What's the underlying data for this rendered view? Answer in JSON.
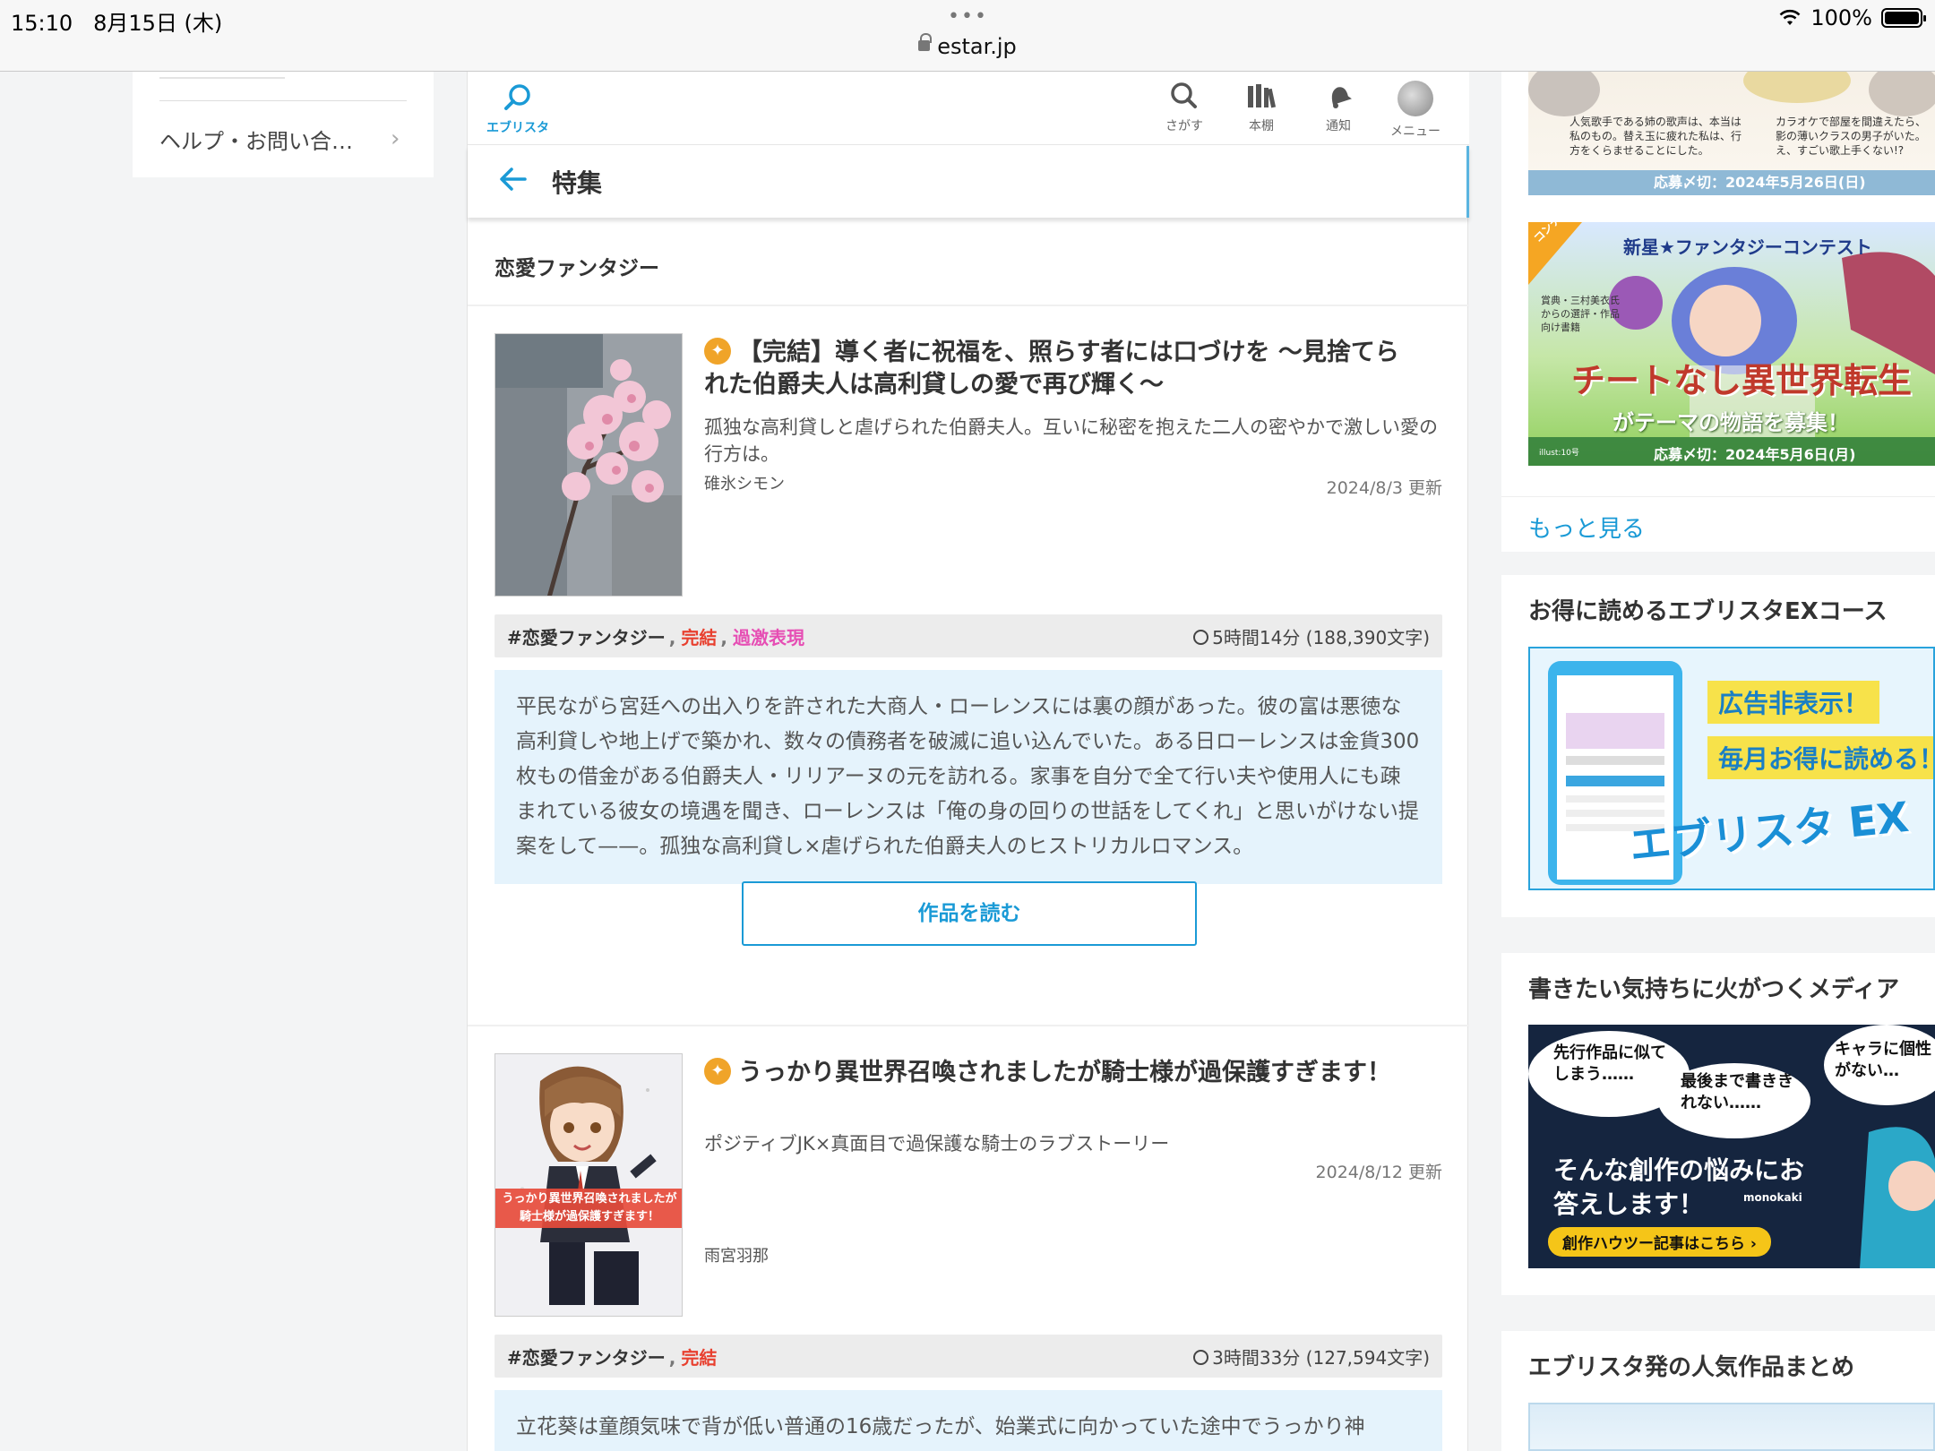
{
  "status_bar": {
    "time": "15:10",
    "date": "8月15日 (木)",
    "dots": "•••",
    "url": "estar.jp",
    "battery": "100%"
  },
  "left_sidebar": {
    "help_label": "ヘルプ・お問い合…",
    "chevron": "›"
  },
  "app_bar": {
    "logo_label": "エブリスタ",
    "nav": [
      {
        "label": "さがす",
        "icon": "search-icon"
      },
      {
        "label": "本棚",
        "icon": "bookshelf-icon"
      },
      {
        "label": "通知",
        "icon": "bell-icon"
      },
      {
        "label": "メニュー",
        "icon": "avatar-icon"
      }
    ]
  },
  "page": {
    "title": "特集",
    "section_title": "恋愛ファンタジー"
  },
  "works": [
    {
      "badge": "✦",
      "title": "【完結】導く者に祝福を、照らす者には口づけを 〜見捨てられた伯爵夫人は高利貸しの愛で再び輝く〜",
      "catch": "孤独な高利貸しと虐げられた伯爵夫人。互いに秘密を抱えた二人の密やかで激しい愛の行方は。",
      "author": "碓氷シモン",
      "updated": "2024/8/3 更新",
      "tags": {
        "genre": "#恋愛ファンタジー",
        "complete": "完結",
        "extreme": "過激表現",
        "sep": ","
      },
      "read_time": "5時間14分 (188,390文字)",
      "synopsis": "平民ながら宮廷への出入りを許された大商人・ローレンスには裏の顔があった。彼の富は悪徳な高利貸しや地上げで築かれ、数々の債務者を破滅に追い込んでいた。ある日ローレンスは金貨300枚もの借金がある伯爵夫人・リリアーヌの元を訪れる。家事を自分で全て行い夫や使用人にも疎まれている彼女の境遇を聞き、ローレンスは「俺の身の回りの世話をしてくれ」と思いがけない提案をして——。孤独な高利貸し×虐げられた伯爵夫人のヒストリカルロマンス。",
      "read_button": "作品を読む"
    },
    {
      "badge": "✦",
      "title": "うっかり異世界召喚されましたが騎士様が過保護すぎます！",
      "catch": "ポジティブJK×真面目で過保護な騎士のラブストーリー",
      "author": "雨宮羽那",
      "updated": "2024/8/12 更新",
      "cover_caption": "うっかり異世界召喚されましたが騎士様が過保護すぎます！",
      "tags": {
        "genre": "#恋愛ファンタジー",
        "complete": "完結",
        "sep": ","
      },
      "read_time": "3時間33分 (127,594文字)",
      "synopsis": "立花葵は童顔気味で背が低い普通の16歳だったが、始業式に向かっていた途中でうっかり神"
    }
  ],
  "right_column": {
    "banner1": {
      "text_left": "人気歌手である姉の歌声は、本当は私のもの。替え玉に疲れた私は、行方をくらませることにした。",
      "text_right": "カラオケで部屋を間違えたら、影の薄いクラスの男子がいた。え、すごい歌上手くない!?",
      "deadline": "応募〆切：2024年5月26日(日)"
    },
    "banner2": {
      "corner": "コンテスト",
      "title": "新星★ファンタジーコンテスト",
      "side_notes": "賞典・三村美衣氏からの選評・作品向け書籍",
      "headline": "チートなし異世界転生",
      "sub": "がテーマの物語を募集！",
      "credit": "illust:10号",
      "deadline": "応募〆切：2024年5月6日(月)"
    },
    "more_link": "もっと見る",
    "ex_heading": "お得に読めるエブリスタEXコース",
    "ex_banner": {
      "line1": "広告非表示！",
      "line2": "毎月お得に読める！",
      "logo": "エブリスタ EX"
    },
    "media_heading": "書きたい気持ちに火がつくメディア",
    "media_banner": {
      "bubble1": "先行作品に似てしまう……",
      "bubble2": "最後まで書ききれない……",
      "bubble3": "キャラに個性がない…",
      "headline": "そんな創作の悩みにお答えします！",
      "brand": "monokaki",
      "cta": "創作ハウツー記事はこちら ›"
    },
    "popular_heading": "エブリスタ発の人気作品まとめ"
  },
  "colors": {
    "brand_blue": "#1a9ad6",
    "synopsis_bg": "#e5f3fc",
    "badge_orange": "#f0a429",
    "tag_red": "#e8402f",
    "tag_pink": "#e64eb4"
  }
}
